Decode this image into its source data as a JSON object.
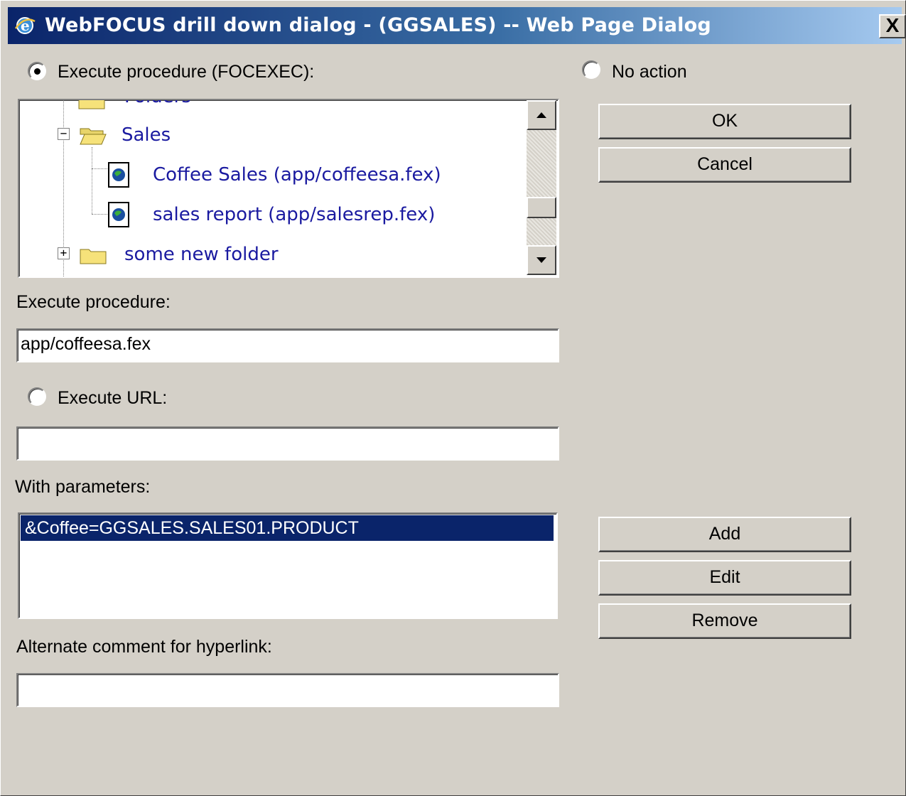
{
  "window": {
    "title": "WebFOCUS drill down dialog - (GGSALES) -- Web Page Dialog",
    "close_label": "X"
  },
  "options": {
    "execute_procedure_focexec_label": "Execute procedure (FOCEXEC):",
    "execute_procedure_focexec_selected": true,
    "no_action_label": "No action",
    "no_action_selected": false,
    "execute_url_label": "Execute URL:",
    "execute_url_selected": false
  },
  "tree": {
    "items": [
      {
        "label": "Sales",
        "type": "folder",
        "expanded": true
      },
      {
        "label": "Coffee Sales (app/coffeesa.fex)",
        "type": "procedure"
      },
      {
        "label": "sales report (app/salesrep.fex)",
        "type": "procedure"
      },
      {
        "label": "some new folder",
        "type": "folder",
        "expanded": false
      }
    ]
  },
  "fields": {
    "execute_procedure_label": "Execute procedure:",
    "execute_procedure_value": "app/coffeesa.fex",
    "execute_url_value": "",
    "parameters_label": "With parameters:",
    "parameters": [
      "&Coffee=GGSALES.SALES01.PRODUCT"
    ],
    "alt_comment_label": "Alternate comment for hyperlink:",
    "alt_comment_value": ""
  },
  "buttons": {
    "ok": "OK",
    "cancel": "Cancel",
    "add": "Add",
    "edit": "Edit",
    "remove": "Remove"
  },
  "icons": {
    "title": "ie-icon",
    "folder": "folder-icon",
    "procedure": "procedure-icon"
  },
  "colors": {
    "titlebar_start": "#0a246a",
    "titlebar_end": "#a6caf0",
    "dialog_bg": "#d4d0c8",
    "tree_text": "#1a1aa0",
    "selection": "#0a246a"
  }
}
